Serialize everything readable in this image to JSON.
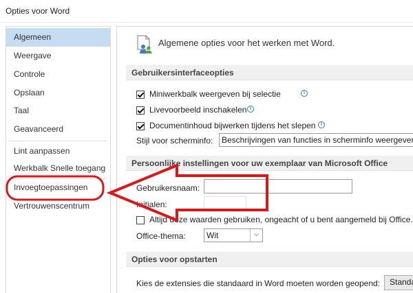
{
  "window": {
    "title": "Opties voor Word"
  },
  "sidebar": {
    "items": [
      {
        "label": "Algemeen",
        "active": true
      },
      {
        "label": "Weergave"
      },
      {
        "label": "Controle"
      },
      {
        "label": "Opslaan"
      },
      {
        "label": "Taal"
      },
      {
        "label": "Geavanceerd"
      },
      {
        "label": "Lint aanpassen"
      },
      {
        "label": "Werkbalk Snelle toegang"
      },
      {
        "label": "Invoegtoepassingen"
      },
      {
        "label": "Vertrouwenscentrum"
      }
    ]
  },
  "main": {
    "header": "Algemene opties voor het werken met Word.",
    "ui_section": {
      "title": "Gebruikersinterfaceopties",
      "options": [
        {
          "label": "Miniwerkbalk weergeven bij selectie",
          "checked": true
        },
        {
          "label": "Livevoorbeeld inschakelen",
          "checked": true
        },
        {
          "label": "Documentinhoud bijwerken tijdens het slepen",
          "checked": true
        }
      ],
      "screentip_label": "Stijl voor scherminfo:",
      "screentip_value": "Beschrijvingen van functies in scherminfo weergeven"
    },
    "personal_section": {
      "title": "Persoonlijke instellingen voor uw exemplaar van Microsoft Office",
      "username_label": "Gebruikersnaam:",
      "username_value": "",
      "initials_label": "Initialen:",
      "initials_value": "",
      "always_label": "Altijd deze waarden gebruiken, ongeacht of u bent aangemeld bij Office.",
      "always_checked": false,
      "theme_label": "Office-thema:",
      "theme_value": "Wit"
    },
    "startup_section": {
      "title": "Opties voor opstarten",
      "extensions_label": "Kies de extensies die standaard in Word moeten worden geopend:",
      "defaults_button": "Standaardprogramma's"
    }
  },
  "annotation": {
    "color": "#d7191c"
  },
  "colors": {
    "active_nav": "#c5dcf3",
    "info_icon": "#2b79c2"
  }
}
